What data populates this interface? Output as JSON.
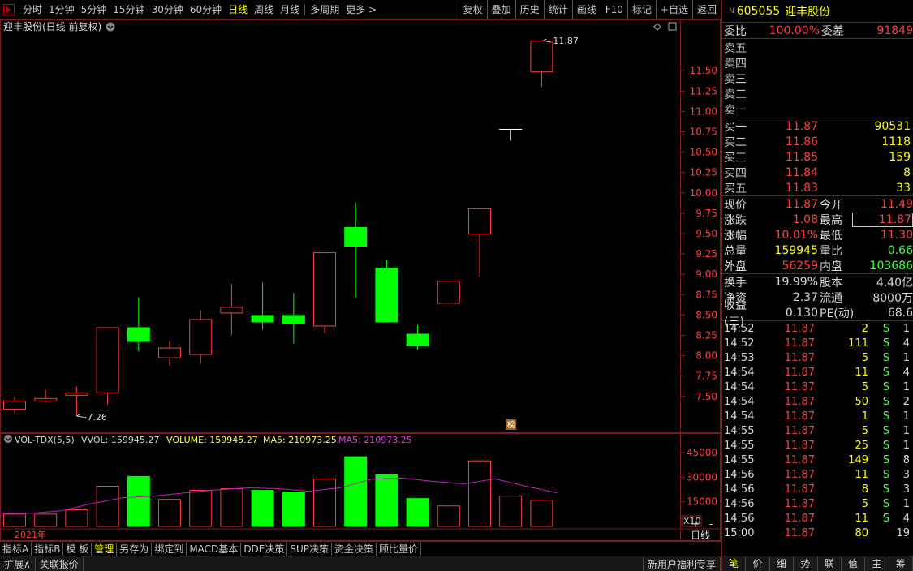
{
  "topbar": {
    "periods": [
      "分时",
      "1分钟",
      "5分钟",
      "15分钟",
      "30分钟",
      "60分钟",
      "日线",
      "周线",
      "月线",
      "多周期",
      "更多 >"
    ],
    "active_period": "日线",
    "right_buttons": [
      "复权",
      "叠加",
      "历史",
      "统计",
      "画线",
      "F10",
      "标记",
      "+自选",
      "返回"
    ]
  },
  "chart": {
    "title": "迎丰股份(日线 前复权)",
    "ytick_labels": [
      "11.50",
      "11.25",
      "11.00",
      "10.75",
      "10.50",
      "10.25",
      "10.00",
      "9.75",
      "9.50",
      "9.25",
      "9.00",
      "8.75",
      "8.50",
      "8.25",
      "8.00",
      "7.75",
      "7.50"
    ],
    "high_marker": "11.87",
    "low_marker": "7.26",
    "year_label": "2021年",
    "badge": "榜",
    "corner_icons": [
      "◇",
      "□"
    ]
  },
  "chart_data": {
    "type": "candlestick",
    "ylim": [
      7.1,
      11.95
    ],
    "candles": [
      {
        "o": 7.35,
        "c": 7.45,
        "h": 7.5,
        "l": 7.3
      },
      {
        "o": 7.45,
        "c": 7.48,
        "h": 7.58,
        "l": 7.43
      },
      {
        "o": 7.52,
        "c": 7.55,
        "h": 7.62,
        "l": 7.26
      },
      {
        "o": 7.55,
        "c": 8.35,
        "h": 8.35,
        "l": 7.4
      },
      {
        "o": 8.35,
        "c": 8.18,
        "h": 8.72,
        "l": 8.05
      },
      {
        "o": 7.98,
        "c": 8.1,
        "h": 8.18,
        "l": 7.88
      },
      {
        "o": 8.02,
        "c": 8.45,
        "h": 8.56,
        "l": 7.9
      },
      {
        "o": 8.53,
        "c": 8.6,
        "h": 8.88,
        "l": 8.25
      },
      {
        "o": 8.5,
        "c": 8.42,
        "h": 8.9,
        "l": 8.32
      },
      {
        "o": 8.5,
        "c": 8.4,
        "h": 8.77,
        "l": 8.15
      },
      {
        "o": 8.37,
        "c": 9.27,
        "h": 9.27,
        "l": 8.28
      },
      {
        "o": 9.58,
        "c": 9.35,
        "h": 9.88,
        "l": 8.72
      },
      {
        "o": 9.08,
        "c": 8.42,
        "h": 9.18,
        "l": 8.42
      },
      {
        "o": 8.27,
        "c": 8.13,
        "h": 8.38,
        "l": 8.07
      },
      {
        "o": 8.65,
        "c": 8.92,
        "h": 8.92,
        "l": 8.65
      },
      {
        "o": 9.5,
        "c": 9.81,
        "h": 9.81,
        "l": 8.97
      },
      {
        "o": 10.78,
        "c": 10.78,
        "h": 10.78,
        "l": 10.64
      },
      {
        "o": 11.49,
        "c": 11.87,
        "h": 11.87,
        "l": 11.3
      }
    ],
    "volume": {
      "title": "VOL-TDX(5,5)",
      "vvol_label": "VVOL: 159945.27",
      "volume_label": "VOLUME: 159945.27",
      "ma5_label": "MA5: 210973.25",
      "ma5b_label": "MA5: 210973.25",
      "ytick_labels": [
        "45000",
        "30000",
        "15000"
      ],
      "unit_label": "X10",
      "ylim": [
        0,
        50000
      ],
      "values": [
        7500,
        7500,
        10200,
        24500,
        30500,
        16500,
        22000,
        23000,
        22000,
        21000,
        29000,
        42500,
        31500,
        17000,
        12500,
        40000,
        18500,
        16000
      ],
      "ma5": [
        8000,
        8000,
        9500,
        14000,
        17500,
        18500,
        20500,
        22300,
        23500,
        23000,
        21500,
        23500,
        28800,
        29500,
        27500,
        26000,
        29000,
        24500,
        20500
      ]
    },
    "series_colors": {
      "up": "#ff3c3c",
      "down": "#00ff00",
      "ma5": "#c020c0"
    }
  },
  "bottombar": {
    "tabs": [
      "指标A",
      "指标B",
      "模 板",
      "管理",
      "另存为",
      "绑定到",
      "MACD基本",
      "DDE决策",
      "SUP决策",
      "资金决策",
      "顾比量价"
    ],
    "active": "管理",
    "right": [
      "+",
      "-",
      "日线"
    ]
  },
  "statusbar": {
    "left": [
      "扩展∧",
      "关联报价"
    ],
    "right": "新用户福利专享"
  },
  "quote": {
    "n": "N",
    "code": "605055",
    "name": "迎丰股份",
    "weibi_label": "委比",
    "weibi": "100.00%",
    "weicha_label": "委差",
    "weicha": "91849",
    "sells": [
      "卖五",
      "卖四",
      "卖三",
      "卖二",
      "卖一"
    ],
    "buys": [
      {
        "label": "买一",
        "price": "11.87",
        "vol": "90531"
      },
      {
        "label": "买二",
        "price": "11.86",
        "vol": "1118"
      },
      {
        "label": "买三",
        "price": "11.85",
        "vol": "159"
      },
      {
        "label": "买四",
        "price": "11.84",
        "vol": "8"
      },
      {
        "label": "买五",
        "price": "11.83",
        "vol": "33"
      }
    ],
    "stats": [
      {
        "l1": "现价",
        "v1": "11.87",
        "l2": "今开",
        "v2": "11.49"
      },
      {
        "l1": "涨跌",
        "v1": "1.08",
        "l2": "最高",
        "v2": "11.87"
      },
      {
        "l1": "涨幅",
        "v1": "10.01%",
        "l2": "最低",
        "v2": "11.30"
      },
      {
        "l1": "总量",
        "v1": "159945",
        "l2": "量比",
        "v2": "0.66"
      },
      {
        "l1": "外盘",
        "v1": "56259",
        "l2": "内盘",
        "v2": "103686"
      }
    ],
    "stats2": [
      {
        "l1": "换手",
        "v1": "19.99%",
        "l2": "股本",
        "v2": "4.40亿"
      },
      {
        "l1": "净资",
        "v1": "2.37",
        "l2": "流通",
        "v2": "8000万"
      },
      {
        "l1": "收益(三)",
        "v1": "0.130",
        "l2": "PE(动)",
        "v2": "68.6"
      }
    ],
    "ticks": [
      {
        "t": "14:52",
        "p": "11.87",
        "v": "2",
        "s": "S",
        "n": "1"
      },
      {
        "t": "14:52",
        "p": "11.87",
        "v": "111",
        "s": "S",
        "n": "4"
      },
      {
        "t": "14:53",
        "p": "11.87",
        "v": "5",
        "s": "S",
        "n": "1"
      },
      {
        "t": "14:54",
        "p": "11.87",
        "v": "11",
        "s": "S",
        "n": "4"
      },
      {
        "t": "14:54",
        "p": "11.87",
        "v": "5",
        "s": "S",
        "n": "1"
      },
      {
        "t": "14:54",
        "p": "11.87",
        "v": "50",
        "s": "S",
        "n": "2"
      },
      {
        "t": "14:54",
        "p": "11.87",
        "v": "1",
        "s": "S",
        "n": "1"
      },
      {
        "t": "14:55",
        "p": "11.87",
        "v": "5",
        "s": "S",
        "n": "1"
      },
      {
        "t": "14:55",
        "p": "11.87",
        "v": "25",
        "s": "S",
        "n": "1"
      },
      {
        "t": "14:55",
        "p": "11.87",
        "v": "149",
        "s": "S",
        "n": "8"
      },
      {
        "t": "14:56",
        "p": "11.87",
        "v": "11",
        "s": "S",
        "n": "3"
      },
      {
        "t": "14:56",
        "p": "11.87",
        "v": "8",
        "s": "S",
        "n": "3"
      },
      {
        "t": "14:56",
        "p": "11.87",
        "v": "5",
        "s": "S",
        "n": "1"
      },
      {
        "t": "14:56",
        "p": "11.87",
        "v": "11",
        "s": "S",
        "n": "4"
      },
      {
        "t": "15:00",
        "p": "11.87",
        "v": "80",
        "s": "",
        "n": "19"
      }
    ],
    "bottom_tabs": [
      "笔",
      "价",
      "细",
      "势",
      "联",
      "值",
      "主",
      "筹"
    ],
    "active_tab": "笔"
  }
}
